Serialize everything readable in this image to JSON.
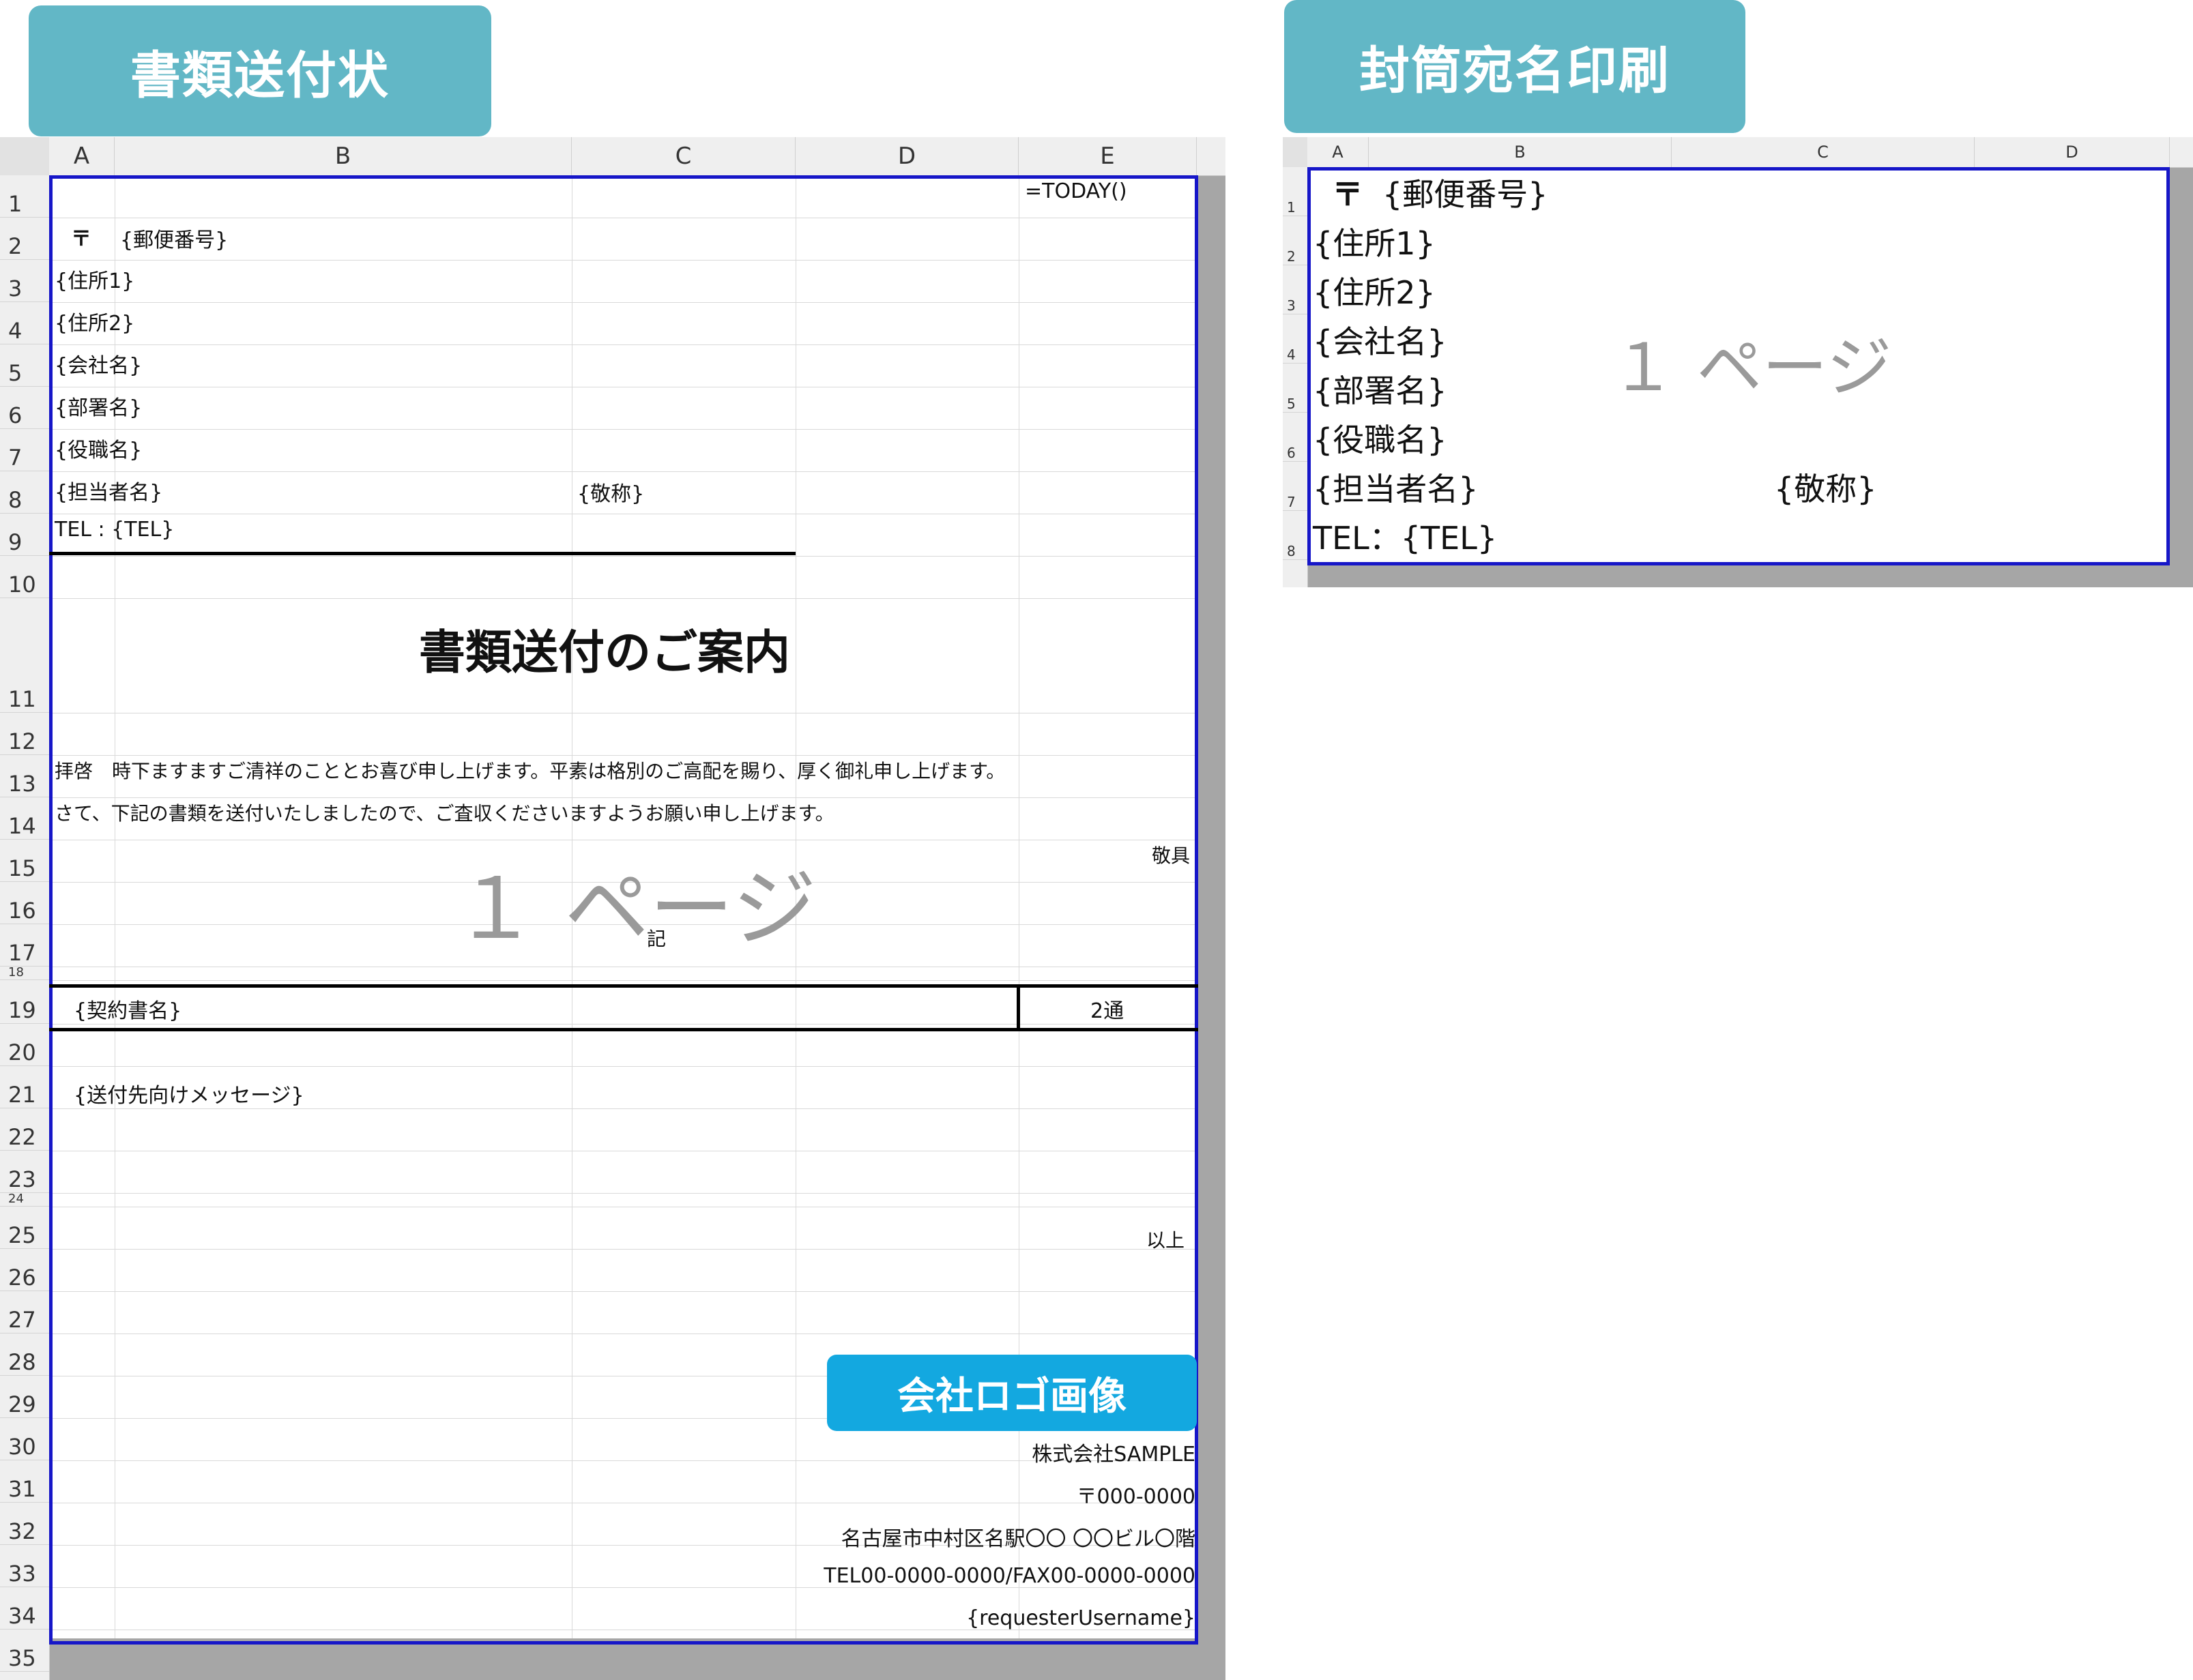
{
  "tabs": {
    "left": "書類送付状",
    "right": "封筒宛名印刷"
  },
  "colors": {
    "tab": "#62b7c6",
    "print_border": "#1616c8",
    "logo": "#13a8e0",
    "gray_bg": "#a6a6a6"
  },
  "sheet1": {
    "columns": [
      "A",
      "B",
      "C",
      "D",
      "E"
    ],
    "rows": [
      "1",
      "2",
      "3",
      "4",
      "5",
      "6",
      "7",
      "8",
      "9",
      "10",
      "11",
      "12",
      "13",
      "14",
      "15",
      "16",
      "17",
      "18",
      "19",
      "20",
      "21",
      "22",
      "23",
      "24",
      "25",
      "26",
      "27",
      "28",
      "29",
      "30",
      "31",
      "32",
      "33",
      "34",
      "35"
    ],
    "cells": {
      "today": "=TODAY()",
      "postal_mark": "〒",
      "postal": "{郵便番号}",
      "addr1": "{住所1}",
      "addr2": "{住所2}",
      "company": "{会社名}",
      "dept": "{部署名}",
      "position": "{役職名}",
      "person": "{担当者名}",
      "honorific": "{敬称}",
      "tel": "TEL : {TEL}",
      "title": "書類送付のご案内",
      "greeting1": "拝啓　時下ますますご清祥のこととお喜び申し上げます。平素は格別のご高配を賜り、厚く御礼申し上げます。",
      "greeting2": "さて、下記の書類を送付いたしましたので、ご査収くださいますようお願い申し上げます。",
      "keigu": "敬具",
      "ki": "記",
      "contract": "{契約書名}",
      "copies": "2通",
      "message": "{送付先向けメッセージ}",
      "ijou": "以上",
      "sender_company": "株式会社SAMPLE",
      "sender_postal": "〒000-0000",
      "sender_addr": "名古屋市中村区名駅〇〇 〇〇ビル〇階",
      "sender_tel": "TEL00-0000-0000/FAX00-0000-0000",
      "requester": "{requesterUsername}"
    },
    "watermark": "１ ページ",
    "logo_label": "会社ロゴ画像"
  },
  "sheet2": {
    "columns": [
      "A",
      "B",
      "C",
      "D"
    ],
    "rows": [
      "1",
      "2",
      "3",
      "4",
      "5",
      "6",
      "7",
      "8"
    ],
    "cells": {
      "postal_mark": "〒",
      "postal": "{郵便番号}",
      "addr1": "{住所1}",
      "addr2": "{住所2}",
      "company": "{会社名}",
      "dept": "{部署名}",
      "position": "{役職名}",
      "person": "{担当者名}",
      "honorific": "{敬称}",
      "tel": "TEL：{TEL}"
    },
    "watermark": "１ ページ"
  }
}
